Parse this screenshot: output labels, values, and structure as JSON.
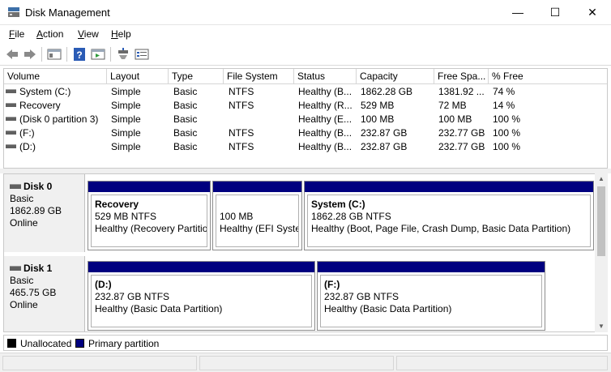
{
  "window": {
    "title": "Disk Management",
    "minimize_glyph": "—",
    "maximize_glyph": "☐",
    "close_glyph": "✕"
  },
  "menu": {
    "items": [
      {
        "first": "F",
        "rest": "ile"
      },
      {
        "first": "A",
        "rest": "ction"
      },
      {
        "first": "V",
        "rest": "iew"
      },
      {
        "first": "H",
        "rest": "elp"
      }
    ]
  },
  "toolbar": {
    "icons": [
      "back-arrow-icon",
      "forward-arrow-icon",
      "console-tree-icon",
      "help-icon",
      "action-pane-icon",
      "connect-icon",
      "properties-icon"
    ]
  },
  "volumes": {
    "columns": [
      "Volume",
      "Layout",
      "Type",
      "File System",
      "Status",
      "Capacity",
      "Free Spa...",
      "% Free"
    ],
    "rows": [
      {
        "volume": "System (C:)",
        "layout": "Simple",
        "type": "Basic",
        "fs": "NTFS",
        "status": "Healthy (B...",
        "capacity": "1862.28 GB",
        "free": "1381.92 ...",
        "pct": "74 %"
      },
      {
        "volume": "Recovery",
        "layout": "Simple",
        "type": "Basic",
        "fs": "NTFS",
        "status": "Healthy (R...",
        "capacity": "529 MB",
        "free": "72 MB",
        "pct": "14 %"
      },
      {
        "volume": "(Disk 0 partition 3)",
        "layout": "Simple",
        "type": "Basic",
        "fs": "",
        "status": "Healthy (E...",
        "capacity": "100 MB",
        "free": "100 MB",
        "pct": "100 %"
      },
      {
        "volume": "(F:)",
        "layout": "Simple",
        "type": "Basic",
        "fs": "NTFS",
        "status": "Healthy (B...",
        "capacity": "232.87 GB",
        "free": "232.77 GB",
        "pct": "100 %"
      },
      {
        "volume": "(D:)",
        "layout": "Simple",
        "type": "Basic",
        "fs": "NTFS",
        "status": "Healthy (B...",
        "capacity": "232.87 GB",
        "free": "232.77 GB",
        "pct": "100 %"
      }
    ]
  },
  "disks": [
    {
      "name": "Disk 0",
      "type": "Basic",
      "size": "1862.89 GB",
      "state": "Online",
      "partitions": [
        {
          "name": "Recovery",
          "size": "529 MB NTFS",
          "status": "Healthy (Recovery Partitio"
        },
        {
          "name": "",
          "size": "100 MB",
          "status": "Healthy (EFI Syster"
        },
        {
          "name": "System  (C:)",
          "size": "1862.28 GB NTFS",
          "status": "Healthy (Boot, Page File, Crash Dump, Basic Data Partition)"
        }
      ]
    },
    {
      "name": "Disk 1",
      "type": "Basic",
      "size": "465.75 GB",
      "state": "Online",
      "partitions": [
        {
          "name": "(D:)",
          "size": "232.87 GB NTFS",
          "status": "Healthy (Basic Data Partition)"
        },
        {
          "name": "(F:)",
          "size": "232.87 GB NTFS",
          "status": "Healthy (Basic Data Partition)"
        }
      ]
    }
  ],
  "legend": {
    "unallocated": "Unallocated",
    "primary": "Primary partition",
    "unallocated_color": "#000000",
    "primary_color": "#00007f"
  }
}
